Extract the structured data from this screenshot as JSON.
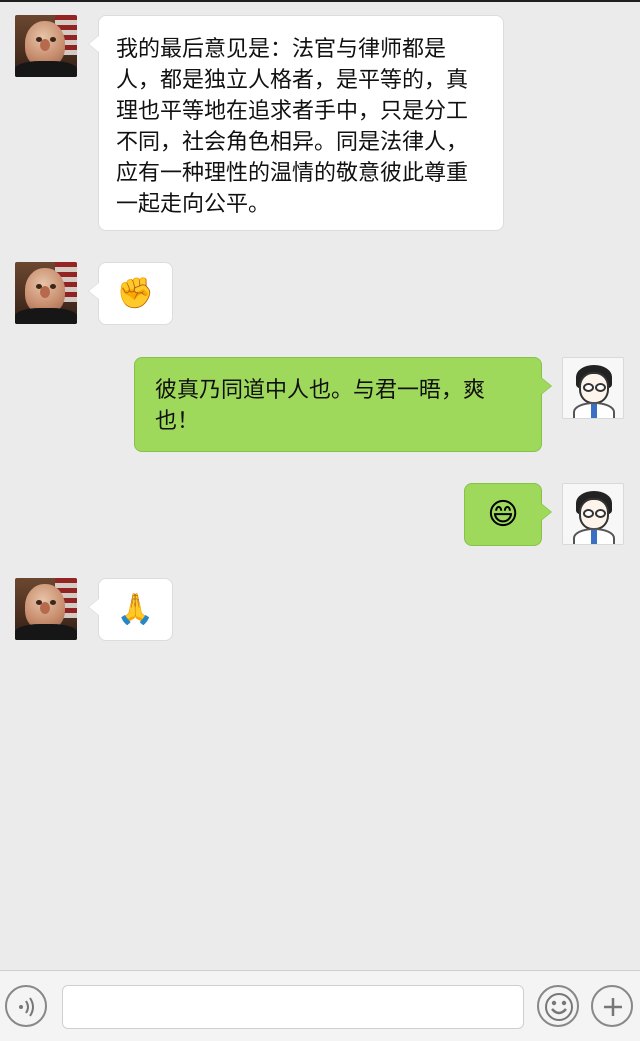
{
  "messages": [
    {
      "side": "left",
      "sender": "judge",
      "text": "我的最后意见是：法官与律师都是人，都是独立人格者，是平等的，真理也平等地在追求者手中，只是分工不同，社会角色相异。同是法律人，应有一种理性的温情的敬意彼此尊重一起走向公平。"
    },
    {
      "side": "left",
      "sender": "judge",
      "emoji": "✊",
      "icon": "fist-emoji"
    },
    {
      "side": "right",
      "sender": "me",
      "text": "彼真乃同道中人也。与君一晤，爽也！"
    },
    {
      "side": "right",
      "sender": "me",
      "emoji": "😄",
      "icon": "grin-emoji"
    },
    {
      "side": "left",
      "sender": "judge",
      "emoji": "🙏",
      "icon": "clasp-hands-emoji"
    }
  ],
  "input_bar": {
    "text_value": "",
    "icons": [
      "voice-icon",
      "emoji-icon",
      "plus-icon"
    ]
  },
  "colors": {
    "background": "#ebebeb",
    "left_bubble": "#ffffff",
    "right_bubble": "#9ed95b"
  }
}
